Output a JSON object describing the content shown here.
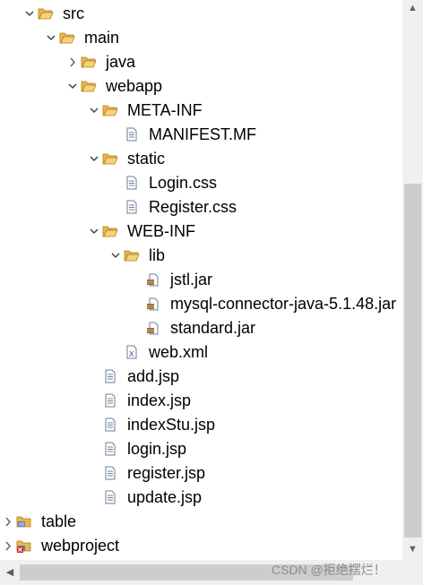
{
  "tree": {
    "rows": [
      {
        "name": "tree-item-src",
        "label": "src",
        "type": "source-folder",
        "depth": 1,
        "chevron": "expanded"
      },
      {
        "name": "tree-item-main",
        "label": "main",
        "type": "folder",
        "depth": 2,
        "chevron": "expanded"
      },
      {
        "name": "tree-item-java",
        "label": "java",
        "type": "folder",
        "depth": 3,
        "chevron": "collapsed"
      },
      {
        "name": "tree-item-webapp",
        "label": "webapp",
        "type": "folder",
        "depth": 3,
        "chevron": "expanded"
      },
      {
        "name": "tree-item-meta-inf",
        "label": "META-INF",
        "type": "folder",
        "depth": 4,
        "chevron": "expanded"
      },
      {
        "name": "tree-item-manifest-mf",
        "label": "MANIFEST.MF",
        "type": "file",
        "depth": 5,
        "chevron": "none"
      },
      {
        "name": "tree-item-static",
        "label": "static",
        "type": "folder",
        "depth": 4,
        "chevron": "expanded"
      },
      {
        "name": "tree-item-login-css",
        "label": "Login.css",
        "type": "file",
        "depth": 5,
        "chevron": "none"
      },
      {
        "name": "tree-item-register-css",
        "label": "Register.css",
        "type": "file",
        "depth": 5,
        "chevron": "none"
      },
      {
        "name": "tree-item-web-inf",
        "label": "WEB-INF",
        "type": "folder",
        "depth": 4,
        "chevron": "expanded"
      },
      {
        "name": "tree-item-lib",
        "label": "lib",
        "type": "folder",
        "depth": 5,
        "chevron": "expanded"
      },
      {
        "name": "tree-item-jstl-jar",
        "label": "jstl.jar",
        "type": "jar",
        "depth": 6,
        "chevron": "none"
      },
      {
        "name": "tree-item-mysql-connector-jar",
        "label": "mysql-connector-java-5.1.48.jar",
        "type": "jar",
        "depth": 6,
        "chevron": "none"
      },
      {
        "name": "tree-item-standard-jar",
        "label": "standard.jar",
        "type": "jar",
        "depth": 6,
        "chevron": "none"
      },
      {
        "name": "tree-item-web-xml",
        "label": "web.xml",
        "type": "xml",
        "depth": 5,
        "chevron": "none"
      },
      {
        "name": "tree-item-add-jsp",
        "label": "add.jsp",
        "type": "jsp",
        "depth": 4,
        "chevron": "none"
      },
      {
        "name": "tree-item-index-jsp",
        "label": "index.jsp",
        "type": "jsp",
        "depth": 4,
        "chevron": "none"
      },
      {
        "name": "tree-item-indexstu-jsp",
        "label": "indexStu.jsp",
        "type": "jsp",
        "depth": 4,
        "chevron": "none"
      },
      {
        "name": "tree-item-login-jsp",
        "label": "login.jsp",
        "type": "jsp",
        "depth": 4,
        "chevron": "none"
      },
      {
        "name": "tree-item-register-jsp",
        "label": "register.jsp",
        "type": "jsp",
        "depth": 4,
        "chevron": "none"
      },
      {
        "name": "tree-item-update-jsp",
        "label": "update.jsp",
        "type": "jsp",
        "depth": 4,
        "chevron": "none"
      },
      {
        "name": "tree-item-table",
        "label": "table",
        "type": "project",
        "depth": 0,
        "chevron": "collapsed"
      },
      {
        "name": "tree-item-webproject",
        "label": "webproject",
        "type": "project-error",
        "depth": 0,
        "chevron": "collapsed"
      }
    ]
  },
  "watermark": "CSDN @拒绝摆烂！",
  "colors": {
    "folder": "#e8b84b",
    "folder_stroke": "#b07d1a",
    "file_stroke": "#6b7f99",
    "jar": "#8b6a2f",
    "error": "#d0302a"
  },
  "icons": {
    "source-folder": "open-folder-icon",
    "folder": "folder-icon",
    "file": "text-file-icon",
    "jar": "jar-file-icon",
    "xml": "xml-file-icon",
    "jsp": "jsp-file-icon",
    "project": "project-icon",
    "project-error": "project-error-icon"
  }
}
